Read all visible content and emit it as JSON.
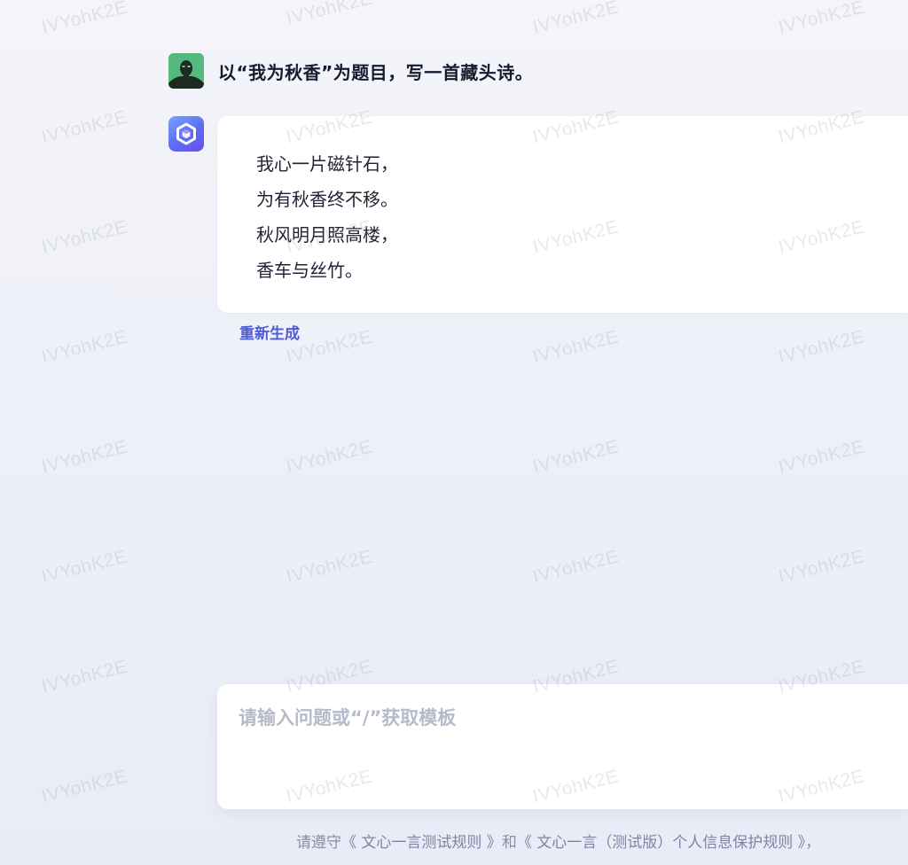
{
  "conversation": {
    "user_message": "以“我为秋香”为题目，写一首藏头诗。",
    "answer": {
      "lines": [
        "我心一片磁针石，",
        "为有秋香终不移。",
        "秋风明月照高楼，",
        "香车与丝竹。"
      ]
    },
    "regenerate_label": "重新生成"
  },
  "input": {
    "placeholder": "请输入问题或“/”获取模板",
    "value": ""
  },
  "footer": {
    "prefix": "请遵守",
    "link_rules": "《 文心一言测试规则 》",
    "conjunction": "和",
    "link_privacy": "《 文心一言（测试版）个人信息保护规则 》",
    "suffix": "，"
  },
  "watermark": {
    "text": "IVYohK2E"
  },
  "colors": {
    "accent": "#4f5bd5",
    "user_avatar": "#3a9e67",
    "bot_avatar": "#5b6cf2",
    "placeholder": "#b7bacb"
  },
  "icons": {
    "user_avatar": "person-silhouette-icon",
    "bot_avatar": "ernie-bot-cube-icon"
  }
}
